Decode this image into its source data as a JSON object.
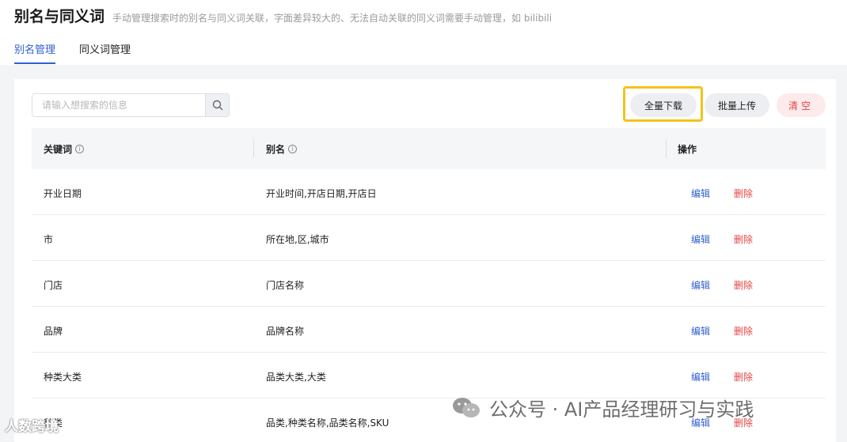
{
  "header": {
    "title": "别名与同义词",
    "description": "手动管理搜索时的别名与同义词关联，字面差异较大的、无法自动关联的同义词需要手动管理，如 bilibili"
  },
  "tabs": [
    {
      "label": "别名管理",
      "active": true
    },
    {
      "label": "同义词管理",
      "active": false
    }
  ],
  "search": {
    "placeholder": "请输入想搜索的信息",
    "value": "",
    "icon": "search-icon"
  },
  "toolbar": {
    "download_label": "全量下载",
    "upload_label": "批量上传",
    "clear_label": "清空"
  },
  "table": {
    "columns": [
      {
        "label": "关键词",
        "info_icon": "ⓘ"
      },
      {
        "label": "别名",
        "info_icon": "ⓘ"
      },
      {
        "label": "操作"
      }
    ],
    "edit_label": "编辑",
    "delete_label": "删除",
    "rows": [
      {
        "keyword": "开业日期",
        "alias": "开业时间,开店日期,开店日"
      },
      {
        "keyword": "市",
        "alias": "所在地,区,城市"
      },
      {
        "keyword": "门店",
        "alias": "门店名称"
      },
      {
        "keyword": "品牌",
        "alias": "品牌名称"
      },
      {
        "keyword": "种类大类",
        "alias": "品类大类,大类"
      },
      {
        "keyword": "种类",
        "alias": "品类,种类名称,品类名称,SKU"
      }
    ]
  },
  "watermarks": {
    "left": "人数跨境",
    "right": "公众号 · AI产品经理研习与实践"
  },
  "colors": {
    "accent": "#2f5fd0",
    "danger": "#e54545",
    "highlight": "#f2c318"
  }
}
